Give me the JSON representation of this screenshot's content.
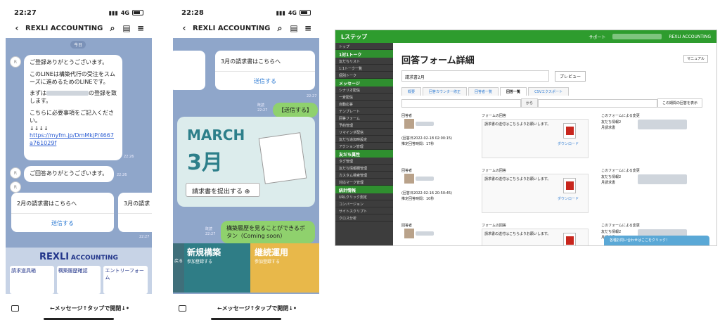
{
  "phone1": {
    "time": "22:27",
    "network": "4G",
    "title": "REXLI ACCOUNTING",
    "date_chip": "今日",
    "msg1": [
      "ご登録ありがとうございます。",
      "",
      "このLINEは構築代行の受注をスムーズに進めるためのLINEです。",
      "",
      "まずは",
      "の登録を致します。",
      "",
      "こちらに必要事項をご記入ください。",
      "↓↓↓↓",
      "https://myfm.jp/DmMkjP/4667a761029f"
    ],
    "msg1_time": "22:26",
    "msg2": "ご回答ありがとうございます。",
    "msg2_time": "22:26",
    "card1_title": "2月の請求書はこちらへ",
    "card1_send": "送信する",
    "card2_title": "3月の請求",
    "card_time": "22:27",
    "menu_logo_a": "REXLI",
    "menu_logo_b": "ACCOUNTING",
    "menu_items": [
      "請求道具箱",
      "構築履歴確認",
      "エントリーフォーム"
    ],
    "bottom_label": "←メッセージ↑タップで開閉↓•"
  },
  "phone2": {
    "time": "22:28",
    "network": "4G",
    "title": "REXLI ACCOUNTING",
    "card_title": "3月の請求書はこちらへ",
    "card_send": "送信する",
    "card_time": "22:27",
    "sent1": "【送信する】",
    "sent1_read": "既読",
    "sent1_time": "22:27",
    "banner_en": "MARCH",
    "banner_jp": "3月",
    "banner_btn": "請求書を提出する",
    "sent2": "構築履歴を見ることができるボタン（Coming soon）",
    "sent2_read": "既読",
    "sent2_time": "22:27",
    "menu_items": [
      {
        "title": "新規構築",
        "sub": "参加登録する"
      },
      {
        "title": "継続運用",
        "sub": "参加登録する"
      }
    ],
    "menu_left": "戻る",
    "bottom_label": "←メッセージ↑タップで開閉↓•"
  },
  "desk": {
    "brand": "Lステップ",
    "top_support": "サポート",
    "top_account": "REXLI ACCOUNTING",
    "side": [
      {
        "t": "トップ"
      },
      {
        "s": "1対1トーク"
      },
      {
        "t": "友だちリスト"
      },
      {
        "t": "1:1トーク一覧"
      },
      {
        "t": "個別トーク"
      },
      {
        "s": "メッセージ"
      },
      {
        "t": "シナリオ配信"
      },
      {
        "t": "一斉配信"
      },
      {
        "t": "自動応答"
      },
      {
        "t": "テンプレート"
      },
      {
        "t": "回答フォーム"
      },
      {
        "t": "予約管理"
      },
      {
        "t": "リマインダ配信"
      },
      {
        "t": "友だち追加時設定"
      },
      {
        "t": "アクション管理"
      },
      {
        "s": "友だち属性"
      },
      {
        "t": "タグ管理"
      },
      {
        "t": "友だち情報欄管理"
      },
      {
        "t": "カスタム検索管理"
      },
      {
        "t": "対応マーク管理"
      },
      {
        "s": "統計情報"
      },
      {
        "t": "URLクリック測定"
      },
      {
        "t": "コンバージョン"
      },
      {
        "t": "サイトスクリプト"
      },
      {
        "t": "クロス分析"
      }
    ],
    "page_title": "回答フォーム詳細",
    "manual_btn": "マニュアル",
    "form_name": "請求書2月",
    "preview_btn": "プレビュー",
    "tabs": [
      "概要",
      "回答カウンター修正",
      "回答者一覧",
      "回答一覧",
      "CSVエクスポート"
    ],
    "search_btn": "から",
    "period_btn": "この期間の回答を表示",
    "col_user": "回答者",
    "col_answer": "フォームの回答",
    "col_change": "このフォームによる変更",
    "answer_text": "請求書の送付はこちらよりお願いします。",
    "download": "ダウンロード",
    "change1": "友だち情報2",
    "change2": "月請求書",
    "rows": [
      {
        "date": "(回答日2022-02-18 02:00:15)",
        "dur": "推定回答時間：17秒"
      },
      {
        "date": "(回答日2022-02-16 20:50:45)",
        "dur": "推定回答時間：10秒"
      },
      {
        "date": "(回答日2022-02-16 17:46:14)",
        "dur": ""
      }
    ],
    "chat_pop": "各種お問い合わせはここをクリック！"
  }
}
